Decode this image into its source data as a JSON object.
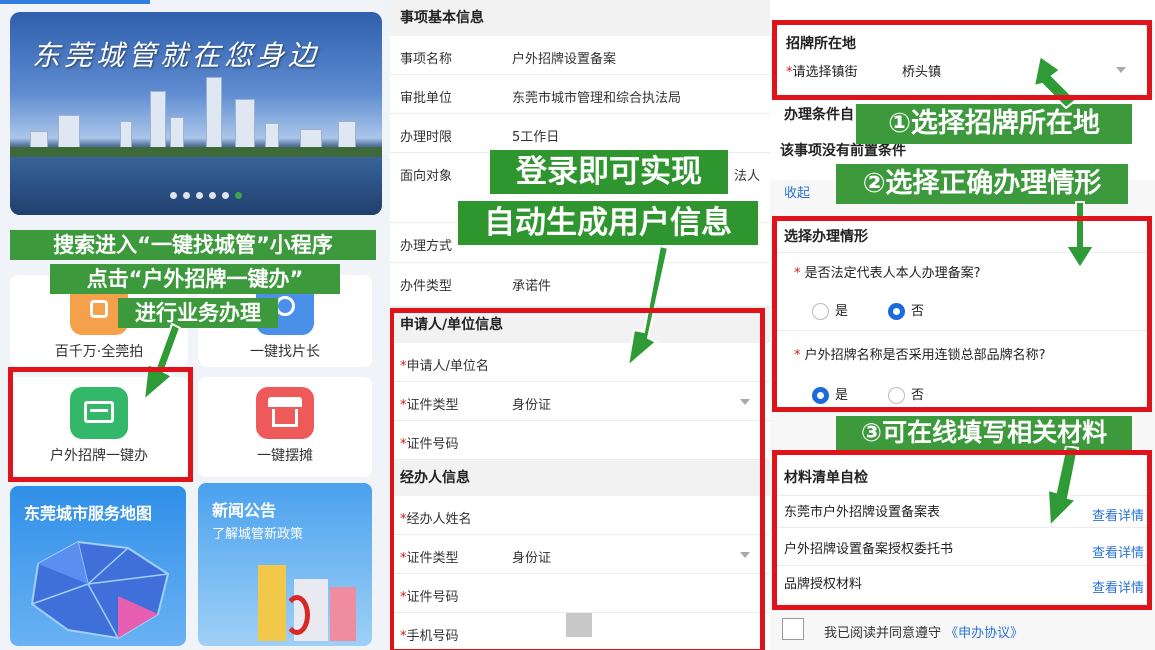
{
  "colors": {
    "accent_green": "#3c9a3c",
    "highlight_red": "#e0131a",
    "link_blue": "#2b72d6",
    "radio_blue": "#1b6be0"
  },
  "panel1": {
    "banner_title": "东莞城管就在您身边",
    "banner_dots": 6,
    "banner_active_dot": 5,
    "tiles": [
      {
        "label": "百千万·全莞拍",
        "icon": "camera-icon"
      },
      {
        "label": "一键找片长",
        "icon": "search-icon"
      },
      {
        "label": "户外招牌一键办",
        "icon": "signboard-icon"
      },
      {
        "label": "一键摆摊",
        "icon": "stall-icon"
      }
    ],
    "map_card": {
      "title": "东莞城市服务地图"
    },
    "news_card": {
      "title": "新闻公告",
      "subtitle": "了解城管新政策"
    },
    "instructions": [
      "搜索进入“一键找城管”小程序",
      "点击“户外招牌一键办”",
      "进行业务办理"
    ]
  },
  "panel2": {
    "section_basic": "事项基本信息",
    "rows": [
      {
        "k": "事项名称",
        "v": "户外招牌设置备案"
      },
      {
        "k": "审批单位",
        "v": "东莞市城市管理和综合执法局"
      },
      {
        "k": "办理时限",
        "v": "5工作日"
      },
      {
        "k": "面向对象",
        "v": "法人"
      },
      {
        "k": "办理方式",
        "v": ""
      },
      {
        "k": "办件类型",
        "v": "承诺件"
      }
    ],
    "overlay": [
      "登录即可实现",
      "自动生成用户信息"
    ],
    "section_applicant": "申请人/单位信息",
    "applicant_rows": [
      {
        "k": "申请人/单位名",
        "v": ""
      },
      {
        "k": "证件类型",
        "v": "身份证"
      },
      {
        "k": "证件号码",
        "v": ""
      }
    ],
    "section_agent": "经办人信息",
    "agent_rows": [
      {
        "k": "经办人姓名",
        "v": ""
      },
      {
        "k": "证件类型",
        "v": "身份证"
      },
      {
        "k": "证件号码",
        "v": ""
      },
      {
        "k": "手机号码",
        "v": ""
      }
    ]
  },
  "panel3": {
    "location_title": "招牌所在地",
    "town_label": "请选择镇街",
    "town_value": "桥头镇",
    "conditions_title": "办理条件自",
    "no_precondition": "该事项没有前置条件",
    "collapse": "收起",
    "situation_title": "选择办理情形",
    "q1": "是否法定代表人本人办理备案?",
    "q1_options": [
      "是",
      "否"
    ],
    "q1_selected": 1,
    "q2": "户外招牌名称是否采用连锁总部品牌名称?",
    "q2_options": [
      "是",
      "否"
    ],
    "q2_selected": 0,
    "materials_title": "材料清单自检",
    "materials": [
      {
        "name": "东莞市户外招牌设置备案表",
        "link": "查看详情"
      },
      {
        "name": "户外招牌设置备案授权委托书",
        "link": "查看详情"
      },
      {
        "name": "品牌授权材料",
        "link": "查看详情"
      }
    ],
    "agree_text": "我已阅读并同意遵守",
    "agree_link": "《申办协议》",
    "step1": "①选择招牌所在地",
    "step2": "②选择正确办理情形",
    "step3": "③可在线填写相关材料"
  }
}
